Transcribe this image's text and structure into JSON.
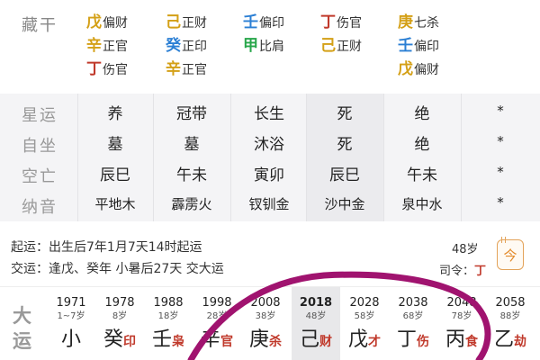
{
  "canggan": {
    "label": "藏干",
    "columns": [
      [
        {
          "stem": "戊",
          "god": "偏财",
          "el": "earth"
        },
        {
          "stem": "辛",
          "god": "正官",
          "el": "metal"
        },
        {
          "stem": "丁",
          "god": "伤官",
          "el": "fire"
        }
      ],
      [
        {
          "stem": "己",
          "god": "正财",
          "el": "earth"
        },
        {
          "stem": "癸",
          "god": "正印",
          "el": "water"
        },
        {
          "stem": "辛",
          "god": "正官",
          "el": "metal"
        }
      ],
      [
        {
          "stem": "壬",
          "god": "偏印",
          "el": "water"
        },
        {
          "stem": "甲",
          "god": "比肩",
          "el": "wood"
        }
      ],
      [
        {
          "stem": "丁",
          "god": "伤官",
          "el": "fire"
        },
        {
          "stem": "己",
          "god": "正财",
          "el": "earth"
        }
      ],
      [
        {
          "stem": "庚",
          "god": "七杀",
          "el": "metal"
        },
        {
          "stem": "壬",
          "god": "偏印",
          "el": "water"
        },
        {
          "stem": "戊",
          "god": "偏财",
          "el": "earth"
        }
      ]
    ]
  },
  "table": {
    "rows": [
      {
        "label": "星运",
        "cells": [
          "养",
          "冠带",
          "长生",
          "死",
          "绝",
          "*"
        ]
      },
      {
        "label": "自坐",
        "cells": [
          "墓",
          "墓",
          "沐浴",
          "死",
          "绝",
          "*"
        ]
      },
      {
        "label": "空亡",
        "cells": [
          "辰巳",
          "午未",
          "寅卯",
          "辰巳",
          "午未",
          "*"
        ]
      },
      {
        "label": "纳音",
        "cells": [
          "平地木",
          "霹雳火",
          "钗钏金",
          "沙中金",
          "泉中水",
          "*"
        ]
      }
    ]
  },
  "qiyun": {
    "line1_key": "起运：",
    "line1_val": "出生后7年1月7天14时起运",
    "line2_key": "交运：",
    "line2_val": "逢戊、癸年 小暑后27天 交大运",
    "age": "48岁",
    "siling_key": "司令：",
    "siling_val": "丁",
    "calc_label": "今"
  },
  "dayun": {
    "label": "大运",
    "columns": [
      {
        "year": "1971",
        "age": "1~7岁",
        "stem": "小",
        "god": ""
      },
      {
        "year": "1978",
        "age": "8岁",
        "stem": "癸",
        "god": "印"
      },
      {
        "year": "1988",
        "age": "18岁",
        "stem": "壬",
        "god": "枭"
      },
      {
        "year": "1998",
        "age": "28岁",
        "stem": "辛",
        "god": "官"
      },
      {
        "year": "2008",
        "age": "38岁",
        "stem": "庚",
        "god": "杀"
      },
      {
        "year": "2018",
        "age": "48岁",
        "stem": "己",
        "god": "财",
        "active": true
      },
      {
        "year": "2028",
        "age": "58岁",
        "stem": "戊",
        "god": "才"
      },
      {
        "year": "2038",
        "age": "68岁",
        "stem": "丁",
        "god": "伤"
      },
      {
        "year": "2048",
        "age": "78岁",
        "stem": "丙",
        "god": "食"
      },
      {
        "year": "2058",
        "age": "88岁",
        "stem": "乙",
        "god": "劫"
      }
    ]
  },
  "colors": {
    "earth": "#d4a017",
    "metal": "#d4a017",
    "fire": "#c0392b",
    "water": "#2b7fd4",
    "wood": "#27a64a",
    "ink_circle": "#a0136f"
  }
}
